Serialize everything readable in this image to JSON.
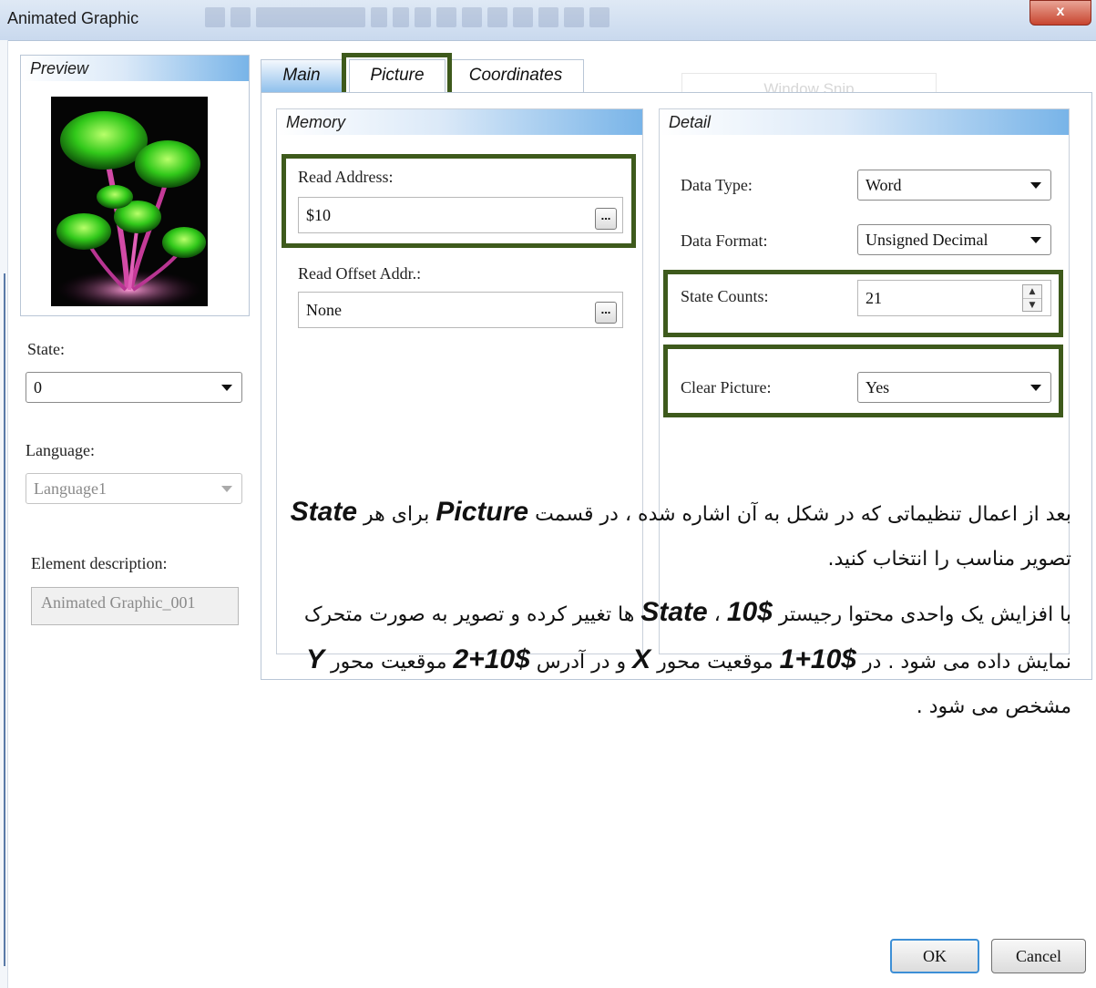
{
  "window": {
    "title": "Animated Graphic",
    "close_glyph": "x"
  },
  "background_ghost": {
    "window_snip": "Window Snip"
  },
  "preview": {
    "header": "Preview",
    "image": "glowing-mushrooms-picture",
    "header_colors": [
      "#ffffff",
      "#dbe9f8",
      "#78b4e8"
    ]
  },
  "state": {
    "label": "State:",
    "value": "0"
  },
  "language": {
    "label": "Language:",
    "value": "Language1"
  },
  "element_description": {
    "label": "Element description:",
    "value": "Animated Graphic_001"
  },
  "tabs": [
    {
      "label": "Main",
      "active": true
    },
    {
      "label": "Picture",
      "active": false,
      "highlighted": true
    },
    {
      "label": "Coordinates",
      "active": false
    }
  ],
  "memory": {
    "header": "Memory",
    "read_address": {
      "label": "Read Address:",
      "value": "$10"
    },
    "read_offset": {
      "label": "Read Offset Addr.:",
      "value": "None"
    },
    "browse_glyph": "..."
  },
  "detail": {
    "header": "Detail",
    "data_type": {
      "label": "Data Type:",
      "value": "Word"
    },
    "data_format": {
      "label": "Data Format:",
      "value": "Unsigned Decimal"
    },
    "state_counts": {
      "label": "State Counts:",
      "value": "21"
    },
    "clear_picture": {
      "label": "Clear Picture:",
      "value": "Yes"
    }
  },
  "annotation": {
    "p1_a": "بعد از اعمال تنظیماتی که در شکل به آن اشاره شده ، در قسمت ",
    "p1_picture": "Picture",
    "p1_b": " برای هر ",
    "p1_state": "State",
    "p1_c": " تصویر مناسب را انتخاب کنید.",
    "p2_a": "با افزایش یک واحدی محتوا رجیستر ",
    "p2_reg": "$10",
    "p2_b": " ، ",
    "p2_state": "State",
    "p2_c": " ها تغییر کرده و تصویر به صورت متحرک نمایش داده می شود . در ",
    "p2_reg1": "$10+1",
    "p2_d": " موقعیت محور ",
    "p2_x": "X",
    "p2_e": " و در آدرس ",
    "p2_reg2": "$10+2",
    "p2_f": " موقعیت  محور ",
    "p2_y": "Y",
    "p2_g": " مشخص می شود ."
  },
  "highlight_color": "#3e5a1c",
  "buttons": {
    "ok": "OK",
    "cancel": "Cancel"
  }
}
